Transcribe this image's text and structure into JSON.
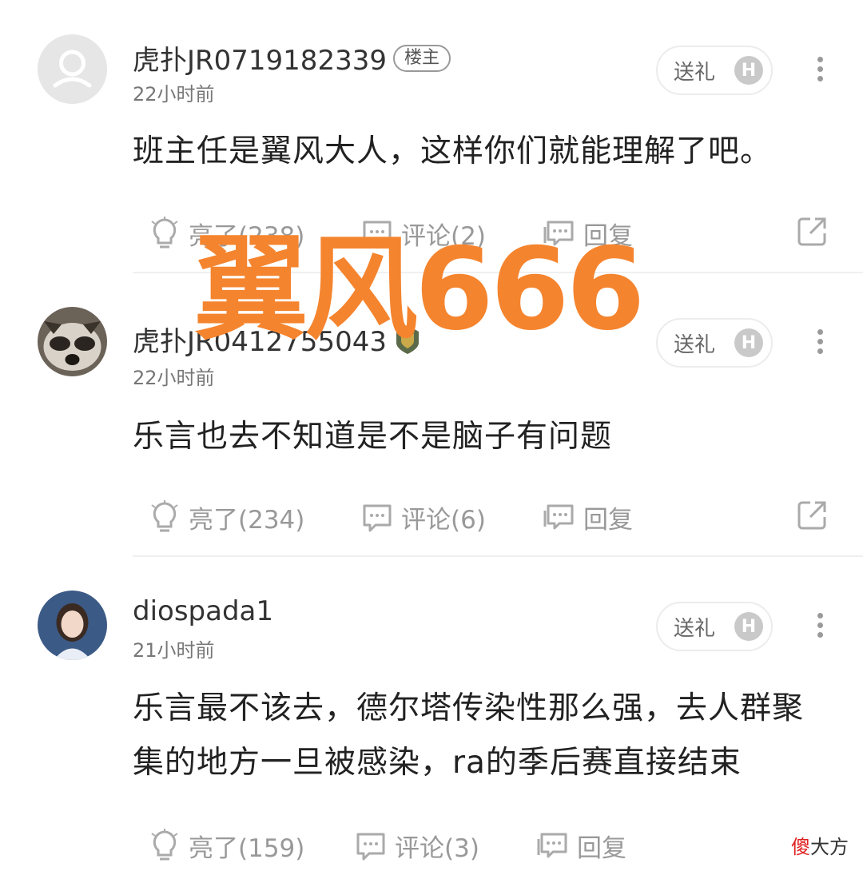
{
  "comments": [
    {
      "username": "虎扑JR0719182339",
      "badge": "楼主",
      "time": "22小时前",
      "gift_label": "送礼",
      "gift_icon": "H",
      "text": "班主任是翼风大人，这样你们就能理解了吧。",
      "like_label": "亮了(238)",
      "comment_label": "评论(2)",
      "reply_label": "回复"
    },
    {
      "username": "虎扑JR0412755043",
      "time": "22小时前",
      "gift_label": "送礼",
      "gift_icon": "H",
      "text": "乐言也去不知道是不是脑子有问题",
      "like_label": "亮了(234)",
      "comment_label": "评论(6)",
      "reply_label": "回复"
    },
    {
      "username": "diospada1",
      "time": "21小时前",
      "gift_label": "送礼",
      "gift_icon": "H",
      "text": "乐言最不该去，德尔塔传染性那么强，去人群聚集的地方一旦被感染，ra的季后赛直接结束",
      "like_label": "亮了(159)",
      "comment_label": "评论(3)",
      "reply_label": "回复"
    }
  ],
  "overlay_text": "翼风666",
  "watermark": {
    "red": "傻",
    "rest": "大方"
  },
  "icons": [
    "avatar-default-icon",
    "bulb-icon",
    "comment-bubble-icon",
    "reply-icon",
    "share-icon",
    "more-icon"
  ],
  "colors": {
    "overlay": "#f5842e",
    "muted": "#999999"
  }
}
